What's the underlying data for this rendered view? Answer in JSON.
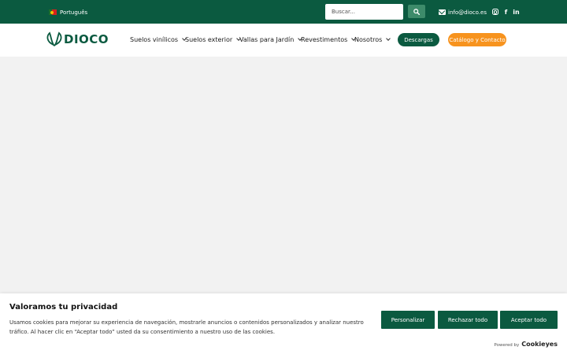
{
  "topbar": {
    "language": "Português",
    "search_placeholder": "Buscar...",
    "email": "info@dioco.es",
    "social": [
      "instagram",
      "facebook",
      "linkedin"
    ],
    "background": "#0b5a40"
  },
  "brand": {
    "logo_text": "DIOCO",
    "color": "#0b5a40"
  },
  "nav": {
    "items": [
      {
        "label": "Suelos vinílicos"
      },
      {
        "label": "Suelos exterior"
      },
      {
        "label": "Vallas para Jardín"
      },
      {
        "label": "Revestimentos"
      },
      {
        "label": "Nosotros"
      }
    ],
    "descargas_label": "Descargas",
    "catalogo_label": "Catálogo y Contacto",
    "accent_orange": "#f7931e"
  },
  "cookie": {
    "title": "Valoramos tu privacidad",
    "text": "Usamos cookies para mejorar su experiencia de navegación, mostrarle anuncios o contenidos personalizados y analizar nuestro tráfico. Al hacer clic en “Aceptar todo” usted da su consentimiento a nuestro uso de las cookies.",
    "personalize_label": "Personalizar",
    "reject_label": "Rechazar todo",
    "accept_label": "Aceptar todo",
    "powered_by": "Powered by",
    "powered_brand": "Cookieyes"
  },
  "icons": {
    "flag": "portugal-flag-icon",
    "search": "search-icon",
    "email": "envelope-icon",
    "logo": "leaf-logo-icon",
    "chevron": "chevron-down-icon"
  }
}
